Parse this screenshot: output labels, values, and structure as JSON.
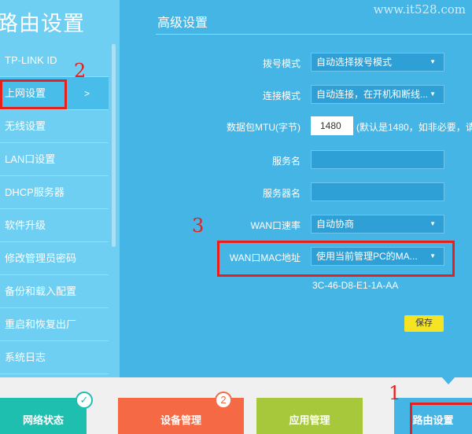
{
  "watermark": "www.it528.com",
  "sidebar": {
    "title": "路由设置",
    "items": [
      {
        "label": "TP-LINK ID"
      },
      {
        "label": "上网设置",
        "arrow": ">"
      },
      {
        "label": "无线设置"
      },
      {
        "label": "LAN口设置"
      },
      {
        "label": "DHCP服务器"
      },
      {
        "label": "软件升级"
      },
      {
        "label": "修改管理员密码"
      },
      {
        "label": "备份和载入配置"
      },
      {
        "label": "重启和恢复出厂"
      },
      {
        "label": "系统日志"
      }
    ]
  },
  "main": {
    "title": "高级设置",
    "dial_mode": {
      "label": "拨号模式",
      "value": "自动选择拨号模式"
    },
    "connect_mode": {
      "label": "连接模式",
      "value": "自动连接，在开机和断线..."
    },
    "mtu": {
      "label": "数据包MTU(字节)",
      "value": "1480",
      "hint": "(默认是1480，如非必要，请"
    },
    "service_name": {
      "label": "服务名",
      "value": ""
    },
    "server_name": {
      "label": "服务器名",
      "value": ""
    },
    "wan_speed": {
      "label": "WAN口速率",
      "value": "自动协商"
    },
    "wan_mac": {
      "label": "WAN口MAC地址",
      "value": "使用当前管理PC的MA...",
      "mac": "3C-46-D8-E1-1A-AA"
    },
    "save_label": "保存"
  },
  "bottom_tabs": [
    {
      "label": "网络状态",
      "badge": "✓"
    },
    {
      "label": "设备管理",
      "badge": "2"
    },
    {
      "label": "应用管理"
    },
    {
      "label": "路由设置"
    }
  ],
  "annotations": [
    "1",
    "2",
    "3"
  ],
  "colors": {
    "sidebar_bg": "#6ecff2",
    "main_bg": "#45b5e5",
    "highlight_red": "#e8201b",
    "save_yellow": "#f4e424",
    "tab_teal": "#1fbfb0",
    "tab_orange": "#f56a45",
    "tab_green": "#a6c83a"
  }
}
